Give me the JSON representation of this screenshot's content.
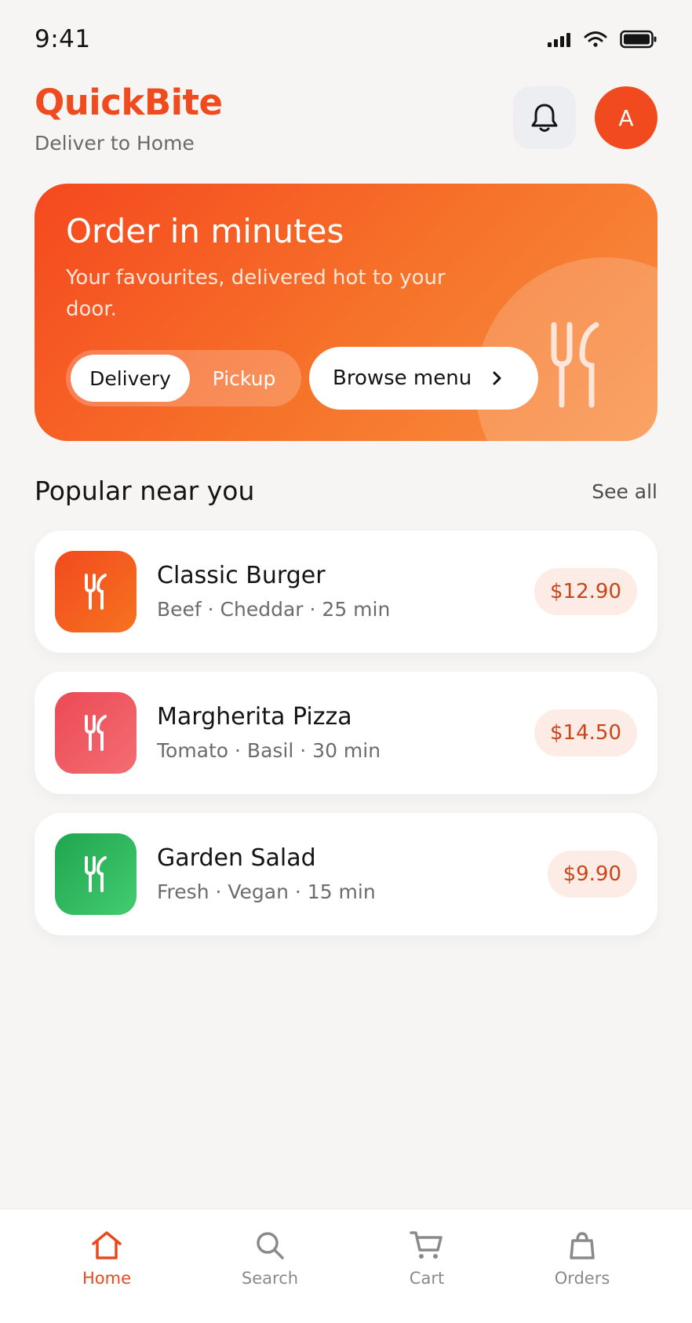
{
  "status_bar": {
    "time": "9:41"
  },
  "header": {
    "brand": "QuickBite",
    "location": "Deliver to Home",
    "avatar_initial": "A"
  },
  "hero": {
    "title": "Order in minutes",
    "subtitle": "Your favourites, delivered hot to your door.",
    "mode_options": [
      "Delivery",
      "Pickup"
    ],
    "mode_selected": "Delivery",
    "browse_label": "Browse menu"
  },
  "section": {
    "title": "Popular near you",
    "see_all": "See all"
  },
  "items": [
    {
      "name": "Classic Burger",
      "meta": "Beef · Cheddar · 25 min",
      "price": "$12.90",
      "color_start": "#f24a1f",
      "color_end": "#f6731f"
    },
    {
      "name": "Margherita Pizza",
      "meta": "Tomato · Basil · 30 min",
      "price": "$14.50",
      "color_start": "#ec4a55",
      "color_end": "#f36d72"
    },
    {
      "name": "Garden Salad",
      "meta": "Fresh · Vegan · 15 min",
      "price": "$9.90",
      "color_start": "#1fa54f",
      "color_end": "#44cc70"
    }
  ],
  "bottom_nav": [
    {
      "label": "Home",
      "icon": "home-icon",
      "active": true
    },
    {
      "label": "Search",
      "icon": "search-icon",
      "active": false
    },
    {
      "label": "Cart",
      "icon": "cart-icon",
      "active": false
    },
    {
      "label": "Orders",
      "icon": "bag-icon",
      "active": false
    }
  ],
  "colors": {
    "accent": "#f04b1f",
    "background": "#f6f5f4",
    "price_bg": "#fdece5",
    "price_text": "#c8461c"
  }
}
